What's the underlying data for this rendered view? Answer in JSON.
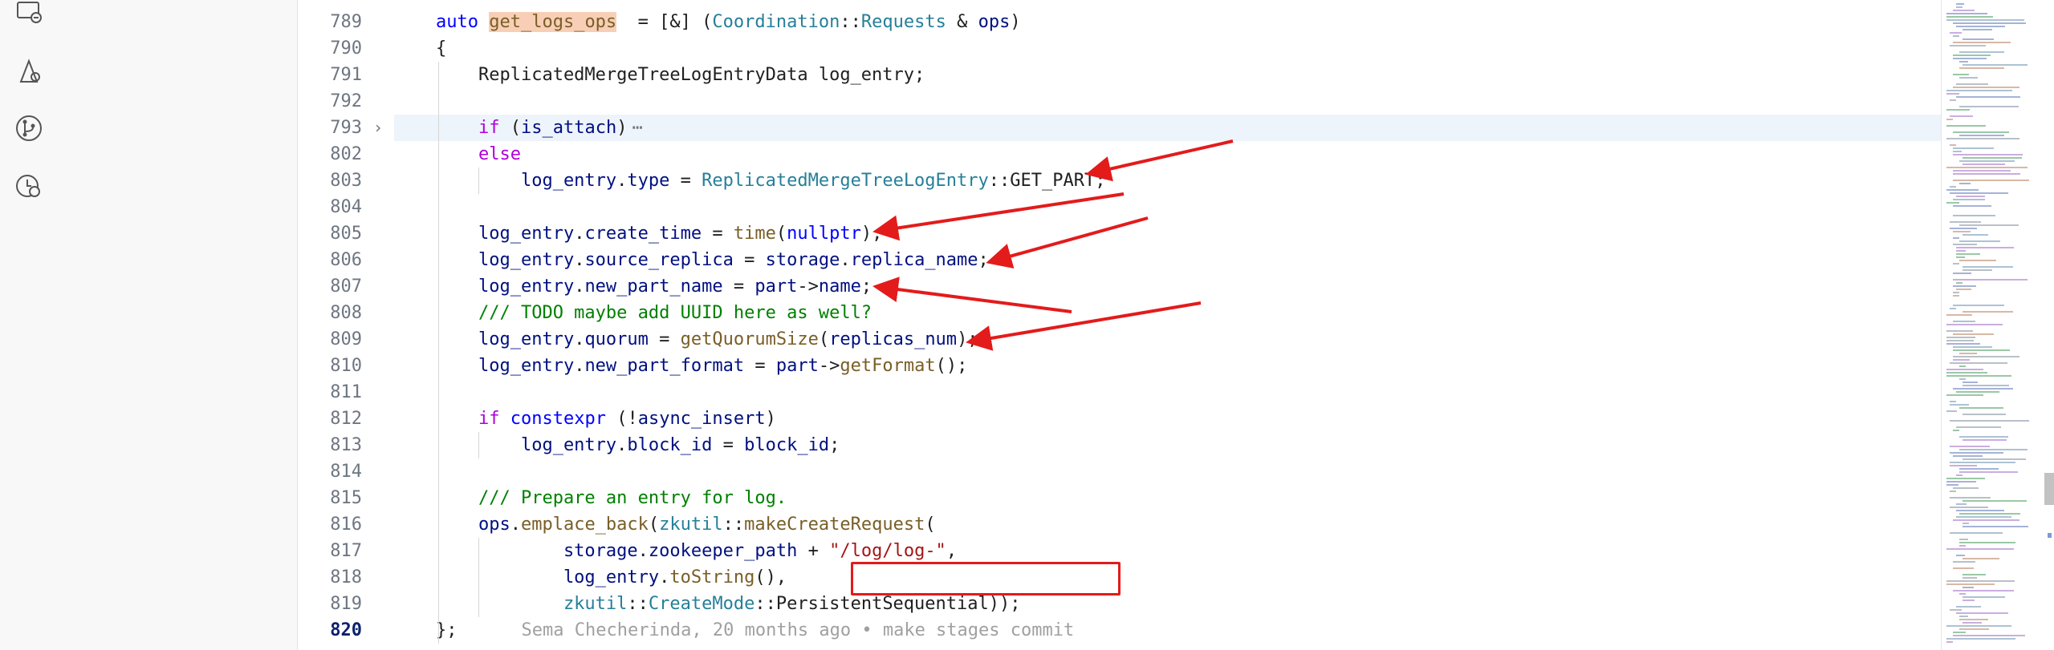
{
  "activity_bar": {
    "icons": [
      "remote-explorer-icon",
      "run-debug-icon",
      "source-control-icon",
      "timeline-icon"
    ]
  },
  "editor": {
    "current_line": "820",
    "lines": [
      {
        "n": "789",
        "tokens": [
          [
            "kw",
            "auto "
          ],
          [
            "fn hl-sym",
            "get_logs_ops"
          ],
          [
            "",
            "  = [&] ("
          ],
          [
            "type",
            "Coordination"
          ],
          [
            "",
            "::"
          ],
          [
            "type",
            "Requests"
          ],
          [
            "",
            " & "
          ],
          [
            "var",
            "ops"
          ],
          [
            "",
            ")"
          ]
        ]
      },
      {
        "n": "790",
        "tokens": [
          [
            "",
            "{"
          ]
        ]
      },
      {
        "n": "791",
        "tokens": [
          [
            "",
            "    ReplicatedMergeTreeLogEntryData log_entry;"
          ]
        ]
      },
      {
        "n": "792",
        "tokens": []
      },
      {
        "n": "793",
        "tokens": [
          [
            "kw2",
            "    if"
          ],
          [
            "",
            " ("
          ],
          [
            "var",
            "is_attach"
          ],
          [
            "",
            ")"
          ]
        ],
        "folded": true
      },
      {
        "n": "802",
        "tokens": [
          [
            "kw2",
            "    else"
          ]
        ]
      },
      {
        "n": "803",
        "tokens": [
          [
            "var",
            "        log_entry"
          ],
          [
            "",
            "."
          ],
          [
            "var",
            "type"
          ],
          [
            "",
            " = "
          ],
          [
            "type",
            "ReplicatedMergeTreeLogEntry"
          ],
          [
            "",
            "::GET_PART;"
          ]
        ]
      },
      {
        "n": "804",
        "tokens": []
      },
      {
        "n": "805",
        "tokens": [
          [
            "var",
            "    log_entry"
          ],
          [
            "",
            "."
          ],
          [
            "var",
            "create_time"
          ],
          [
            "",
            " = "
          ],
          [
            "fn",
            "time"
          ],
          [
            "",
            "("
          ],
          [
            "kw",
            "nullptr"
          ],
          [
            "",
            ");"
          ]
        ]
      },
      {
        "n": "806",
        "tokens": [
          [
            "var",
            "    log_entry"
          ],
          [
            "",
            "."
          ],
          [
            "var",
            "source_replica"
          ],
          [
            "",
            " = "
          ],
          [
            "var",
            "storage"
          ],
          [
            "",
            "."
          ],
          [
            "var",
            "replica_name"
          ],
          [
            "",
            ";"
          ]
        ]
      },
      {
        "n": "807",
        "tokens": [
          [
            "var",
            "    log_entry"
          ],
          [
            "",
            "."
          ],
          [
            "var",
            "new_part_name"
          ],
          [
            "",
            " = "
          ],
          [
            "var",
            "part"
          ],
          [
            "",
            "->"
          ],
          [
            "var",
            "name"
          ],
          [
            "",
            ";"
          ]
        ]
      },
      {
        "n": "808",
        "tokens": [
          [
            "cmt",
            "    /// TODO maybe add UUID here as well?"
          ]
        ]
      },
      {
        "n": "809",
        "tokens": [
          [
            "var",
            "    log_entry"
          ],
          [
            "",
            "."
          ],
          [
            "var",
            "quorum"
          ],
          [
            "",
            " = "
          ],
          [
            "fn",
            "getQuorumSize"
          ],
          [
            "",
            "("
          ],
          [
            "var",
            "replicas_num"
          ],
          [
            "",
            ");"
          ]
        ]
      },
      {
        "n": "810",
        "tokens": [
          [
            "var",
            "    log_entry"
          ],
          [
            "",
            "."
          ],
          [
            "var",
            "new_part_format"
          ],
          [
            "",
            " = "
          ],
          [
            "var",
            "part"
          ],
          [
            "",
            "->"
          ],
          [
            "fn",
            "getFormat"
          ],
          [
            "",
            "();"
          ]
        ]
      },
      {
        "n": "811",
        "tokens": []
      },
      {
        "n": "812",
        "tokens": [
          [
            "kw2",
            "    if"
          ],
          [
            "",
            " "
          ],
          [
            "kw",
            "constexpr"
          ],
          [
            "",
            " (!"
          ],
          [
            "var",
            "async_insert"
          ],
          [
            "",
            ")"
          ]
        ]
      },
      {
        "n": "813",
        "tokens": [
          [
            "var",
            "        log_entry"
          ],
          [
            "",
            "."
          ],
          [
            "var",
            "block_id"
          ],
          [
            "",
            " = "
          ],
          [
            "var",
            "block_id"
          ],
          [
            "",
            ";"
          ]
        ]
      },
      {
        "n": "814",
        "tokens": []
      },
      {
        "n": "815",
        "tokens": [
          [
            "cmt",
            "    /// Prepare an entry for log."
          ]
        ]
      },
      {
        "n": "816",
        "tokens": [
          [
            "var",
            "    ops"
          ],
          [
            "",
            "."
          ],
          [
            "fn",
            "emplace_back"
          ],
          [
            "",
            "("
          ],
          [
            "type",
            "zkutil"
          ],
          [
            "",
            "::"
          ],
          [
            "fn",
            "makeCreateRequest"
          ],
          [
            "",
            "("
          ]
        ]
      },
      {
        "n": "817",
        "tokens": [
          [
            "var",
            "            storage"
          ],
          [
            "",
            "."
          ],
          [
            "var",
            "zookeeper_path"
          ],
          [
            "",
            " + "
          ],
          [
            "str",
            "\"/log/log-\""
          ],
          [
            "",
            ","
          ]
        ]
      },
      {
        "n": "818",
        "tokens": [
          [
            "var",
            "            log_entry"
          ],
          [
            "",
            "."
          ],
          [
            "fn",
            "toString"
          ],
          [
            "",
            "(),"
          ]
        ]
      },
      {
        "n": "819",
        "tokens": [
          [
            "type",
            "            zkutil"
          ],
          [
            "",
            "::"
          ],
          [
            "type",
            "CreateMode"
          ],
          [
            "",
            "::PersistentSequential));"
          ]
        ]
      },
      {
        "n": "820",
        "tokens": [
          [
            "",
            "};"
          ]
        ],
        "blame": "Sema Checherinda, 20 months ago • make stages commit"
      }
    ],
    "fold_ellipsis": "⋯"
  },
  "colors": {
    "annotation_red": "#e31b1b",
    "line_highlight": "#eef4fb",
    "symbol_highlight": "#f8cfb6"
  }
}
